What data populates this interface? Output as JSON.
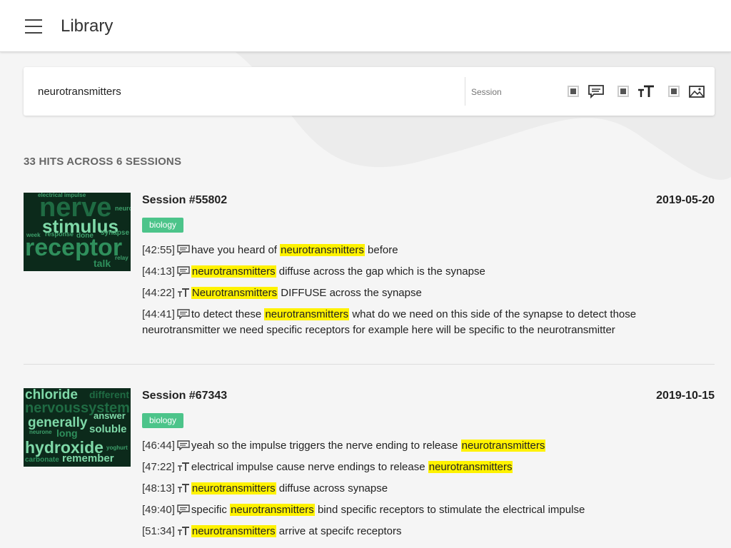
{
  "app": {
    "title": "Library"
  },
  "search": {
    "query": "neurotransmitters",
    "session_placeholder": "Session"
  },
  "filters": [
    {
      "name": "speech",
      "icon": "speech-bubble-icon",
      "checked": true
    },
    {
      "name": "text",
      "icon": "text-size-icon",
      "checked": true
    },
    {
      "name": "image",
      "icon": "image-icon",
      "checked": true
    }
  ],
  "summary": "33 HITS ACROSS 6 SESSIONS",
  "sessions": [
    {
      "name": "Session #55802",
      "date": "2019-05-20",
      "tag": "biology",
      "wordcloud": [
        "nerve",
        "stimulus",
        "receptor",
        "talk",
        "electrical impulse",
        "neuron",
        "synapse",
        "relay",
        "done",
        "response",
        "week"
      ],
      "hits": [
        {
          "time": "[42:55]",
          "kind": "speech",
          "before": "have you heard of ",
          "match": "neurotransmitters",
          "after": " before"
        },
        {
          "time": "[44:13]",
          "kind": "speech",
          "before": "",
          "match": "neurotransmitters",
          "after": " diffuse across the gap which is the synapse"
        },
        {
          "time": "[44:22]",
          "kind": "text",
          "before": "",
          "match": "Neurotransmitters",
          "after": " DIFFUSE across the synapse"
        },
        {
          "time": "[44:41]",
          "kind": "speech",
          "before": "to detect these ",
          "match": "neurotransmitters",
          "after": " what do we need on this side of the synapse to detect those neurotransmitter we need specific receptors for example here will be specific to the neurotransmitter"
        }
      ]
    },
    {
      "name": "Session #67343",
      "date": "2019-10-15",
      "tag": "biology",
      "wordcloud": [
        "chloride",
        "nervous",
        "system",
        "generally",
        "answer",
        "soluble",
        "long",
        "hydroxide",
        "remember",
        "carbonate",
        "neurone",
        "yoghurt",
        "different"
      ],
      "hits": [
        {
          "time": "[46:44]",
          "kind": "speech",
          "before": "yeah so the impulse triggers the nerve ending to release ",
          "match": "neurotransmitters",
          "after": ""
        },
        {
          "time": "[47:22]",
          "kind": "text",
          "before": "electrical impulse cause nerve endings to release ",
          "match": "neurotransmitters",
          "after": ""
        },
        {
          "time": "[48:13]",
          "kind": "text",
          "before": "",
          "match": "neurotransmitters",
          "after": " diffuse across synapse"
        },
        {
          "time": "[49:40]",
          "kind": "speech",
          "before": "specific ",
          "match": "neurotransmitters",
          "after": " bind specific receptors to stimulate the electrical impulse"
        },
        {
          "time": "[51:34]",
          "kind": "text",
          "before": "",
          "match": "neurotransmitters",
          "after": " arrive at specifc receptors"
        }
      ]
    }
  ]
}
